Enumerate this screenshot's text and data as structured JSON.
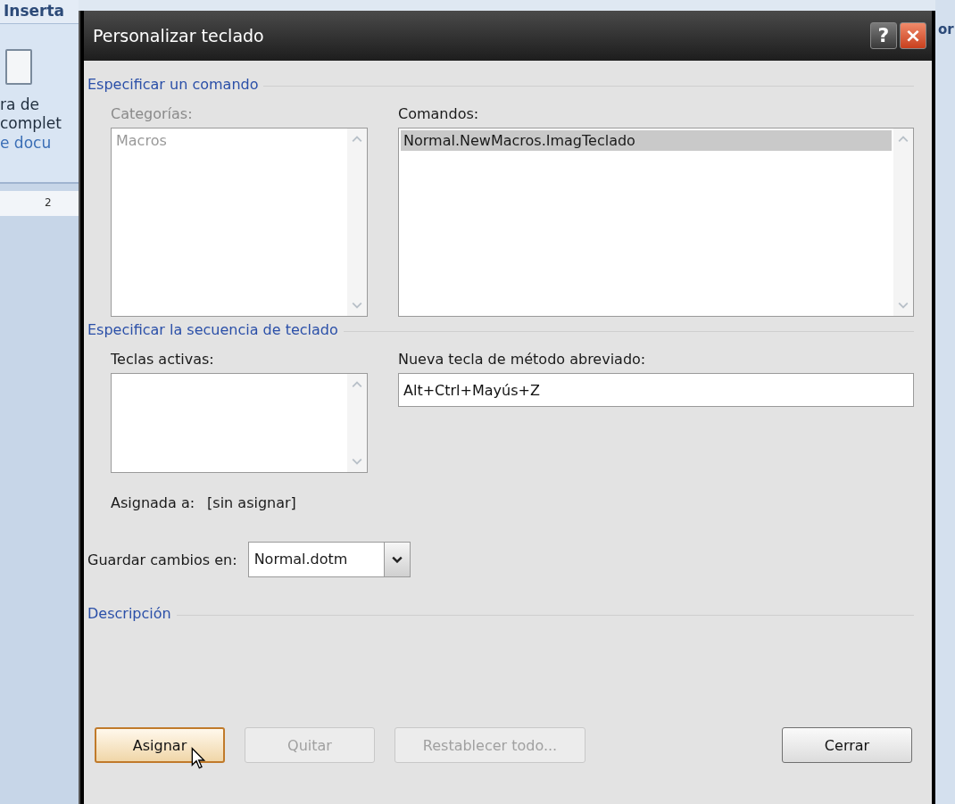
{
  "background_window": {
    "ribbon_tab": "Inserta",
    "ribbon_labels": [
      "ra de",
      "complet"
    ],
    "ribbon_link": "e docu",
    "ruler_mark": "2",
    "right_edge": "or"
  },
  "dialog": {
    "title": "Personalizar teclado",
    "help_button": "?",
    "close_button": "×"
  },
  "command_section": {
    "heading": "Especificar un comando",
    "categories": {
      "label": "Categorías:",
      "disabled": true,
      "items": [
        {
          "text": "Macros",
          "selected": false
        }
      ]
    },
    "commands": {
      "label": "Comandos:",
      "disabled": false,
      "items": [
        {
          "text": "Normal.NewMacros.ImagTeclado",
          "selected": true
        }
      ]
    }
  },
  "keys_section": {
    "heading": "Especificar la secuencia de teclado",
    "active_keys": {
      "label": "Teclas activas:"
    },
    "new_shortcut": {
      "label": "Nueva tecla de método abreviado:",
      "value": "Alt+Ctrl+Mayús+Z"
    },
    "assigned_label": "Asignada a:",
    "assigned_value": "[sin asignar]",
    "save_in": {
      "label": "Guardar cambios en:",
      "value": "Normal.dotm"
    }
  },
  "description_section": {
    "heading": "Descripción"
  },
  "buttons": [
    {
      "label": "Asignar",
      "disabled": false,
      "focused": true,
      "kind": "action"
    },
    {
      "label": "Quitar",
      "disabled": true,
      "focused": false,
      "kind": "action"
    },
    {
      "label": "Restablecer todo...",
      "disabled": true,
      "focused": false,
      "kind": "action"
    },
    {
      "label": "Cerrar",
      "disabled": false,
      "focused": false,
      "kind": "close"
    }
  ]
}
